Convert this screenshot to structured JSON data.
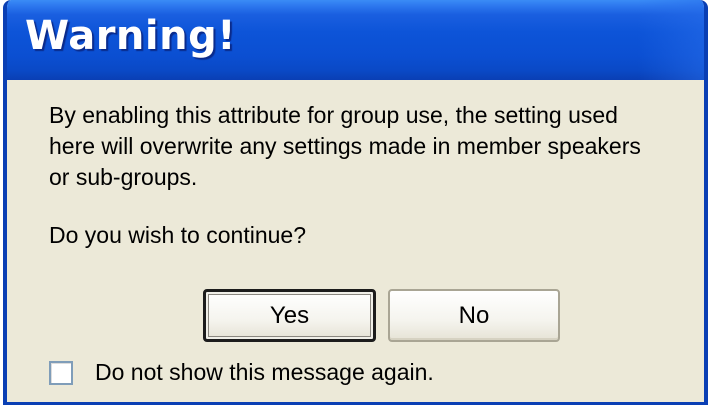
{
  "dialog": {
    "title": "Warning!",
    "message": "By enabling this attribute for group use, the setting used here will overwrite any settings made in member speakers or sub-groups.",
    "message_lines": [
      "By enabling this attribute for group use, the setting used",
      "here will overwrite any settings made in member speakers",
      "or sub-groups."
    ],
    "question": "Do you wish to continue?",
    "buttons": {
      "yes_label": "Yes",
      "no_label": "No",
      "default": "Yes"
    },
    "checkbox": {
      "label": "Do not show this message again.",
      "checked": false
    },
    "colors": {
      "titlebar": "#0b4fd2",
      "title_text": "#ffffff",
      "body_bg": "#ece9d8",
      "frame": "#0a3fb4"
    }
  }
}
